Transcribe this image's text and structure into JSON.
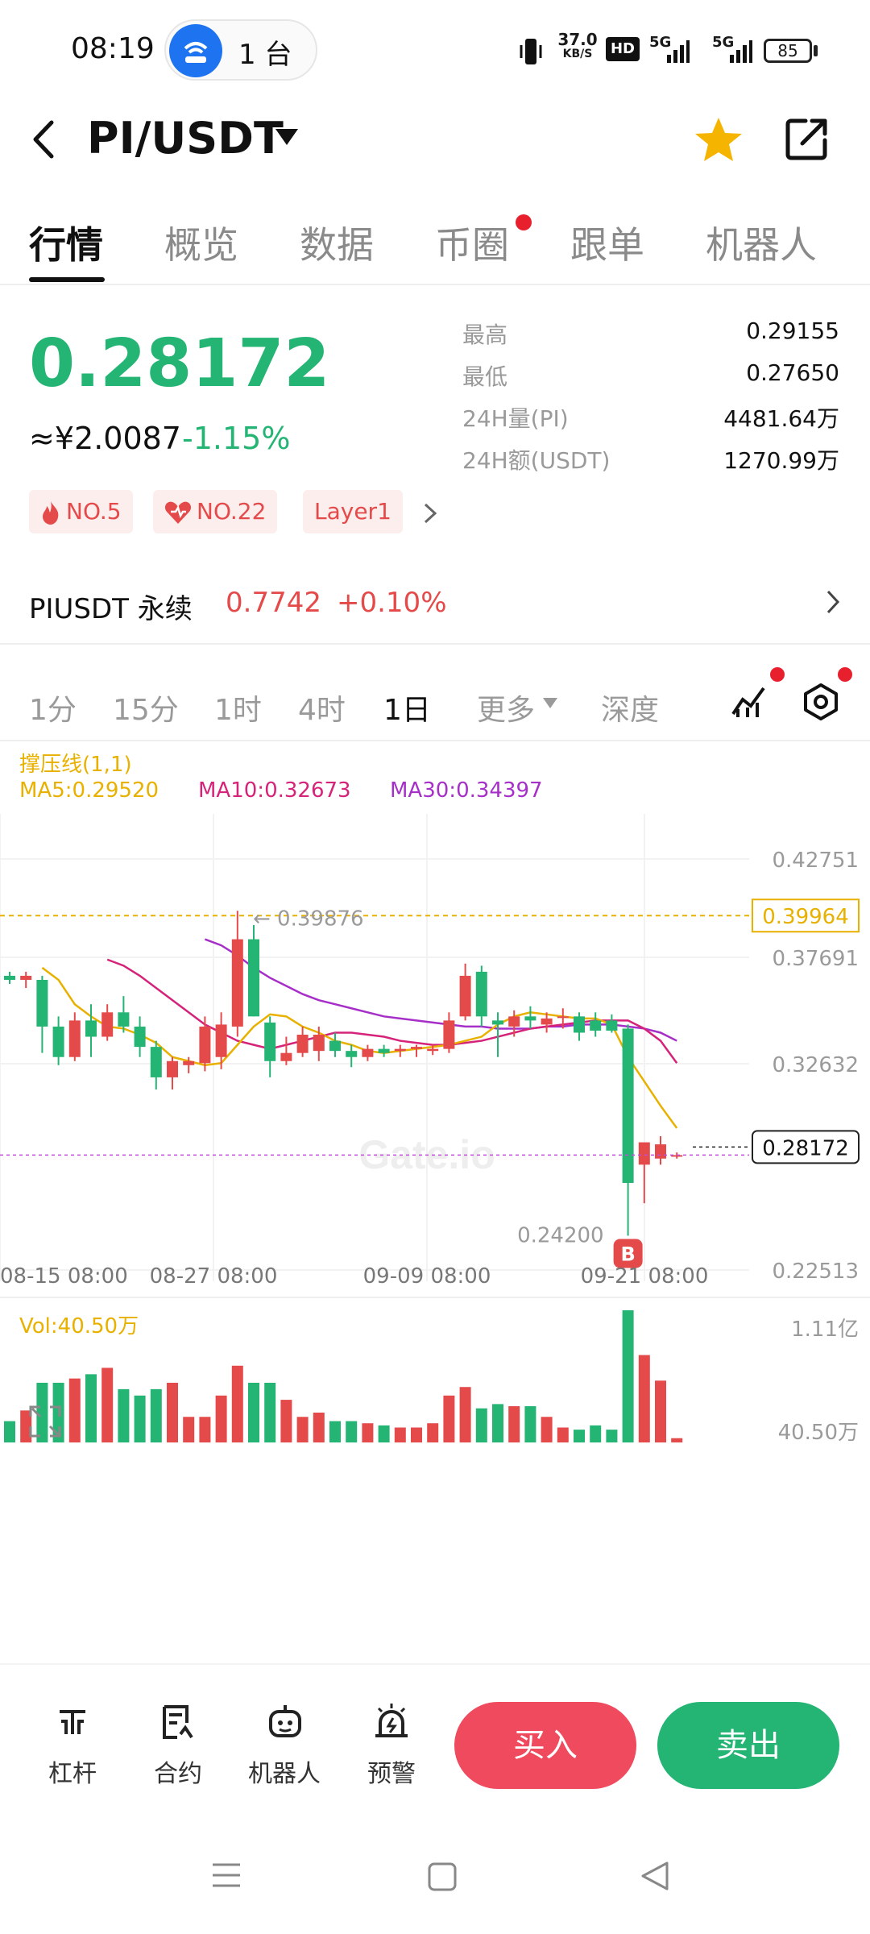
{
  "status_bar": {
    "time": "08:19",
    "hotspot_count": "1 台",
    "net_speed_value": "37.0",
    "net_speed_unit": "KB/S",
    "hd_badge": "HD",
    "signal1": "5G",
    "signal2": "5G",
    "battery": "85"
  },
  "header": {
    "pair": "PI/USDT",
    "favorite_color": "#f5b400"
  },
  "tabs": [
    {
      "label": "行情",
      "active": true
    },
    {
      "label": "概览"
    },
    {
      "label": "数据"
    },
    {
      "label": "币圈",
      "dot": true
    },
    {
      "label": "跟单"
    },
    {
      "label": "机器人"
    }
  ],
  "price": {
    "last": "0.28172",
    "cny": "≈¥2.0087",
    "change_pct": "-1.15%",
    "color_up": "#24b574",
    "color_down": "#e54a4a"
  },
  "stats": [
    {
      "label": "最高",
      "value": "0.29155"
    },
    {
      "label": "最低",
      "value": "0.27650"
    },
    {
      "label": "24H量(PI)",
      "value": "4481.64万"
    },
    {
      "label": "24H额(USDT)",
      "value": "1270.99万"
    }
  ],
  "tags": [
    {
      "icon": "fire-icon",
      "label": "NO.5"
    },
    {
      "icon": "heart-icon",
      "label": "NO.22"
    },
    {
      "label": "Layer1"
    }
  ],
  "perpetual": {
    "label": "PIUSDT 永续",
    "price": "0.7742",
    "change": "+0.10%"
  },
  "intervals": [
    {
      "label": "1分"
    },
    {
      "label": "15分"
    },
    {
      "label": "1时"
    },
    {
      "label": "4时"
    },
    {
      "label": "1日",
      "active": true
    },
    {
      "label": "更多"
    },
    {
      "label": "深度"
    }
  ],
  "legend": {
    "indicator": "撑压线(1,1)",
    "ma5": "MA5:0.29520",
    "ma10": "MA10:0.32673",
    "ma30": "MA30:0.34397",
    "ma5_color": "#e8b100",
    "ma10_color": "#d6237a",
    "ma30_color": "#a62fc8"
  },
  "chart_data": {
    "type": "candlestick",
    "y_ticks": [
      "0.42751",
      "0.37691",
      "0.32632",
      "0.22513"
    ],
    "ylim": [
      0.22513,
      0.42751
    ],
    "x_ticks": [
      "08-15 08:00",
      "08-27 08:00",
      "09-09 08:00",
      "09-21 08:00"
    ],
    "resistance_label": "← 0.39876",
    "resistance_value": 0.39876,
    "support_line_value": 0.39964,
    "support_tag": "0.39964",
    "current_price_tag": "0.28172",
    "current_price": 0.28172,
    "low_marker": "0.24200",
    "low_value": 0.242,
    "buy_marker": "B",
    "watermark": "Gate.io",
    "candles": [
      {
        "o": 0.37,
        "h": 0.372,
        "l": 0.366,
        "c": 0.368
      },
      {
        "o": 0.368,
        "h": 0.372,
        "l": 0.364,
        "c": 0.37
      },
      {
        "o": 0.368,
        "h": 0.37,
        "l": 0.332,
        "c": 0.345
      },
      {
        "o": 0.345,
        "h": 0.35,
        "l": 0.326,
        "c": 0.33
      },
      {
        "o": 0.33,
        "h": 0.352,
        "l": 0.328,
        "c": 0.348
      },
      {
        "o": 0.348,
        "h": 0.356,
        "l": 0.33,
        "c": 0.34
      },
      {
        "o": 0.34,
        "h": 0.356,
        "l": 0.338,
        "c": 0.352
      },
      {
        "o": 0.352,
        "h": 0.36,
        "l": 0.342,
        "c": 0.345
      },
      {
        "o": 0.345,
        "h": 0.35,
        "l": 0.33,
        "c": 0.335
      },
      {
        "o": 0.335,
        "h": 0.338,
        "l": 0.314,
        "c": 0.32
      },
      {
        "o": 0.32,
        "h": 0.33,
        "l": 0.314,
        "c": 0.328
      },
      {
        "o": 0.326,
        "h": 0.33,
        "l": 0.322,
        "c": 0.328
      },
      {
        "o": 0.327,
        "h": 0.35,
        "l": 0.323,
        "c": 0.345
      },
      {
        "o": 0.33,
        "h": 0.352,
        "l": 0.324,
        "c": 0.346
      },
      {
        "o": 0.345,
        "h": 0.402,
        "l": 0.34,
        "c": 0.388
      },
      {
        "o": 0.388,
        "h": 0.395,
        "l": 0.35,
        "c": 0.35
      },
      {
        "o": 0.347,
        "h": 0.35,
        "l": 0.32,
        "c": 0.328
      },
      {
        "o": 0.328,
        "h": 0.34,
        "l": 0.326,
        "c": 0.332
      },
      {
        "o": 0.332,
        "h": 0.345,
        "l": 0.33,
        "c": 0.341
      },
      {
        "o": 0.333,
        "h": 0.345,
        "l": 0.328,
        "c": 0.341
      },
      {
        "o": 0.338,
        "h": 0.342,
        "l": 0.33,
        "c": 0.333
      },
      {
        "o": 0.333,
        "h": 0.336,
        "l": 0.325,
        "c": 0.33
      },
      {
        "o": 0.33,
        "h": 0.336,
        "l": 0.328,
        "c": 0.334
      },
      {
        "o": 0.334,
        "h": 0.336,
        "l": 0.33,
        "c": 0.332
      },
      {
        "o": 0.333,
        "h": 0.336,
        "l": 0.33,
        "c": 0.334
      },
      {
        "o": 0.334,
        "h": 0.336,
        "l": 0.33,
        "c": 0.335
      },
      {
        "o": 0.333,
        "h": 0.336,
        "l": 0.331,
        "c": 0.334
      },
      {
        "o": 0.334,
        "h": 0.352,
        "l": 0.332,
        "c": 0.348
      },
      {
        "o": 0.35,
        "h": 0.376,
        "l": 0.348,
        "c": 0.37
      },
      {
        "o": 0.372,
        "h": 0.375,
        "l": 0.345,
        "c": 0.35
      },
      {
        "o": 0.348,
        "h": 0.352,
        "l": 0.33,
        "c": 0.346
      },
      {
        "o": 0.345,
        "h": 0.353,
        "l": 0.34,
        "c": 0.35
      },
      {
        "o": 0.35,
        "h": 0.355,
        "l": 0.344,
        "c": 0.348
      },
      {
        "o": 0.346,
        "h": 0.352,
        "l": 0.342,
        "c": 0.349
      },
      {
        "o": 0.35,
        "h": 0.354,
        "l": 0.344,
        "c": 0.35
      },
      {
        "o": 0.35,
        "h": 0.352,
        "l": 0.338,
        "c": 0.342
      },
      {
        "o": 0.348,
        "h": 0.352,
        "l": 0.34,
        "c": 0.343
      },
      {
        "o": 0.348,
        "h": 0.351,
        "l": 0.342,
        "c": 0.343
      },
      {
        "o": 0.344,
        "h": 0.346,
        "l": 0.242,
        "c": 0.268
      },
      {
        "o": 0.277,
        "h": 0.287,
        "l": 0.258,
        "c": 0.288
      },
      {
        "o": 0.28,
        "h": 0.291,
        "l": 0.277,
        "c": 0.287
      },
      {
        "o": 0.2817,
        "h": 0.283,
        "l": 0.28,
        "c": 0.2817
      }
    ],
    "ma5_points": [
      0.374,
      0.368,
      0.356,
      0.35,
      0.345,
      0.344,
      0.341,
      0.337,
      0.33,
      0.328,
      0.326,
      0.327,
      0.336,
      0.345,
      0.351,
      0.35,
      0.345,
      0.342,
      0.338,
      0.336,
      0.333,
      0.332,
      0.333,
      0.334,
      0.335,
      0.336,
      0.338,
      0.34,
      0.346,
      0.35,
      0.352,
      0.351,
      0.35,
      0.349,
      0.349,
      0.346,
      0.33,
      0.318,
      0.306,
      0.295
    ],
    "ma10_points": [
      0.378,
      0.375,
      0.37,
      0.364,
      0.358,
      0.352,
      0.346,
      0.342,
      0.338,
      0.336,
      0.334,
      0.336,
      0.338,
      0.34,
      0.342,
      0.342,
      0.341,
      0.34,
      0.338,
      0.337,
      0.336,
      0.336,
      0.337,
      0.338,
      0.34,
      0.342,
      0.344,
      0.345,
      0.346,
      0.347,
      0.348,
      0.348,
      0.348,
      0.344,
      0.338,
      0.327
    ],
    "ma30_points": [
      0.388,
      0.385,
      0.38,
      0.374,
      0.369,
      0.365,
      0.361,
      0.358,
      0.356,
      0.354,
      0.352,
      0.35,
      0.349,
      0.348,
      0.347,
      0.346,
      0.345,
      0.345,
      0.344,
      0.344,
      0.344,
      0.345,
      0.345,
      0.346,
      0.346,
      0.346,
      0.345,
      0.344,
      0.342,
      0.338
    ],
    "volume_label": "Vol:40.50万",
    "vol_axis_top": "1.11亿",
    "vol_axis_bottom": "40.50万",
    "volumes": [
      0.1,
      0.15,
      0.28,
      0.28,
      0.3,
      0.32,
      0.35,
      0.25,
      0.22,
      0.25,
      0.28,
      0.12,
      0.12,
      0.22,
      0.36,
      0.28,
      0.28,
      0.2,
      0.12,
      0.14,
      0.1,
      0.1,
      0.09,
      0.08,
      0.07,
      0.07,
      0.09,
      0.22,
      0.26,
      0.16,
      0.18,
      0.17,
      0.17,
      0.12,
      0.07,
      0.06,
      0.08,
      0.06,
      0.62,
      0.41,
      0.29,
      0.02
    ]
  },
  "footer": [
    {
      "label": "杠杆",
      "icon": "leverage-icon"
    },
    {
      "label": "合约",
      "icon": "contract-icon"
    },
    {
      "label": "机器人",
      "icon": "robot-icon"
    },
    {
      "label": "预警",
      "icon": "alarm-icon"
    }
  ],
  "buy_label": "买入",
  "sell_label": "卖出"
}
